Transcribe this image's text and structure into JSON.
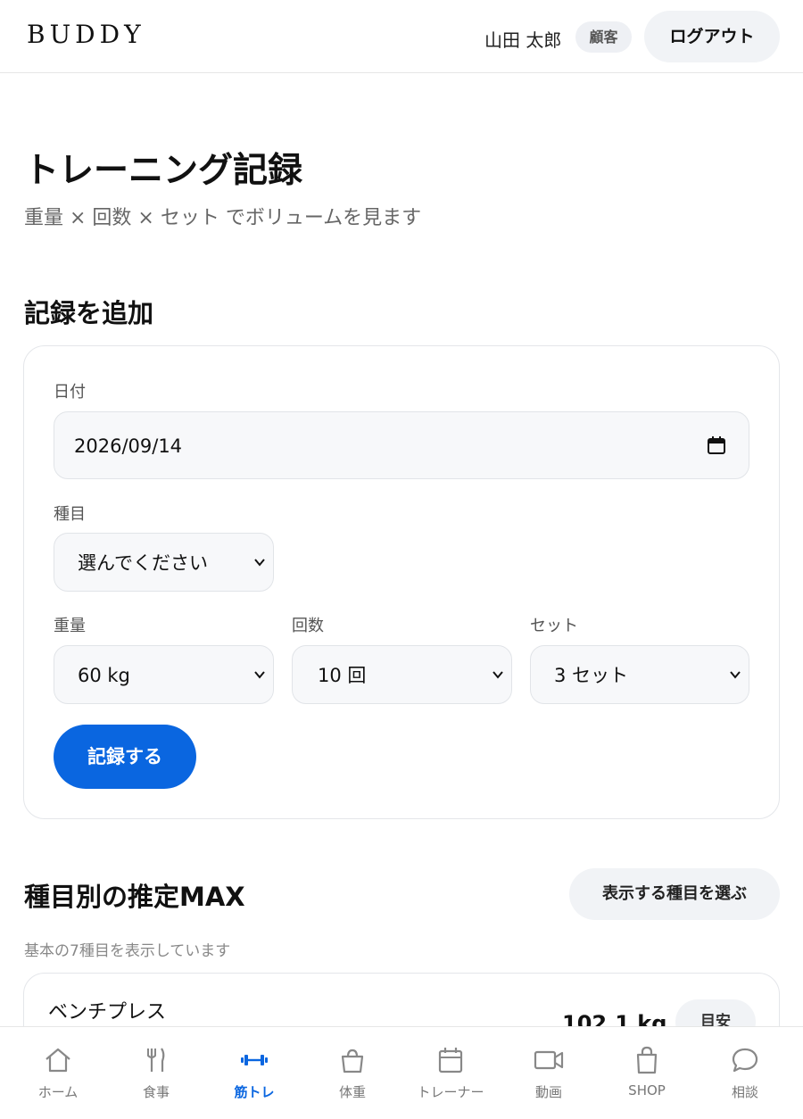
{
  "header": {
    "brand": "BUDDY",
    "user_name": "山田 太郎",
    "role": "顧客",
    "logout_label": "ログアウト"
  },
  "page": {
    "title": "トレーニング記録",
    "subtitle": "重量 × 回数 × セット でボリュームを見ます"
  },
  "add_record": {
    "section_title": "記録を追加",
    "date_label": "日付",
    "date_value": "2026/09/14",
    "exercise_label": "種目",
    "exercise_value": "選んでください",
    "weight_label": "重量",
    "weight_value": "60 kg",
    "reps_label": "回数",
    "reps_value": "10 回",
    "sets_label": "セット",
    "sets_value": "3 セット",
    "submit_label": "記録する"
  },
  "max_section": {
    "title": "種目別の推定MAX",
    "choose_label": "表示する種目を選ぶ",
    "note": "基本の7種目を表示しています",
    "items": [
      {
        "name": "ベンチプレス",
        "value": "102.1 kg",
        "badge": "目安"
      }
    ]
  },
  "bottom_nav": {
    "items": [
      {
        "label": "ホーム",
        "icon": "home-icon"
      },
      {
        "label": "食事",
        "icon": "fork-knife-icon"
      },
      {
        "label": "筋トレ",
        "icon": "dumbbell-icon",
        "active": true
      },
      {
        "label": "体重",
        "icon": "scale-icon"
      },
      {
        "label": "トレーナー",
        "icon": "calendar-icon"
      },
      {
        "label": "動画",
        "icon": "video-icon"
      },
      {
        "label": "SHOP",
        "icon": "shopping-bag-icon"
      },
      {
        "label": "相談",
        "icon": "chat-bubble-icon"
      }
    ]
  },
  "colors": {
    "accent": "#0a66e0",
    "surface": "#f7f8fa",
    "border": "#e4e6ea"
  }
}
